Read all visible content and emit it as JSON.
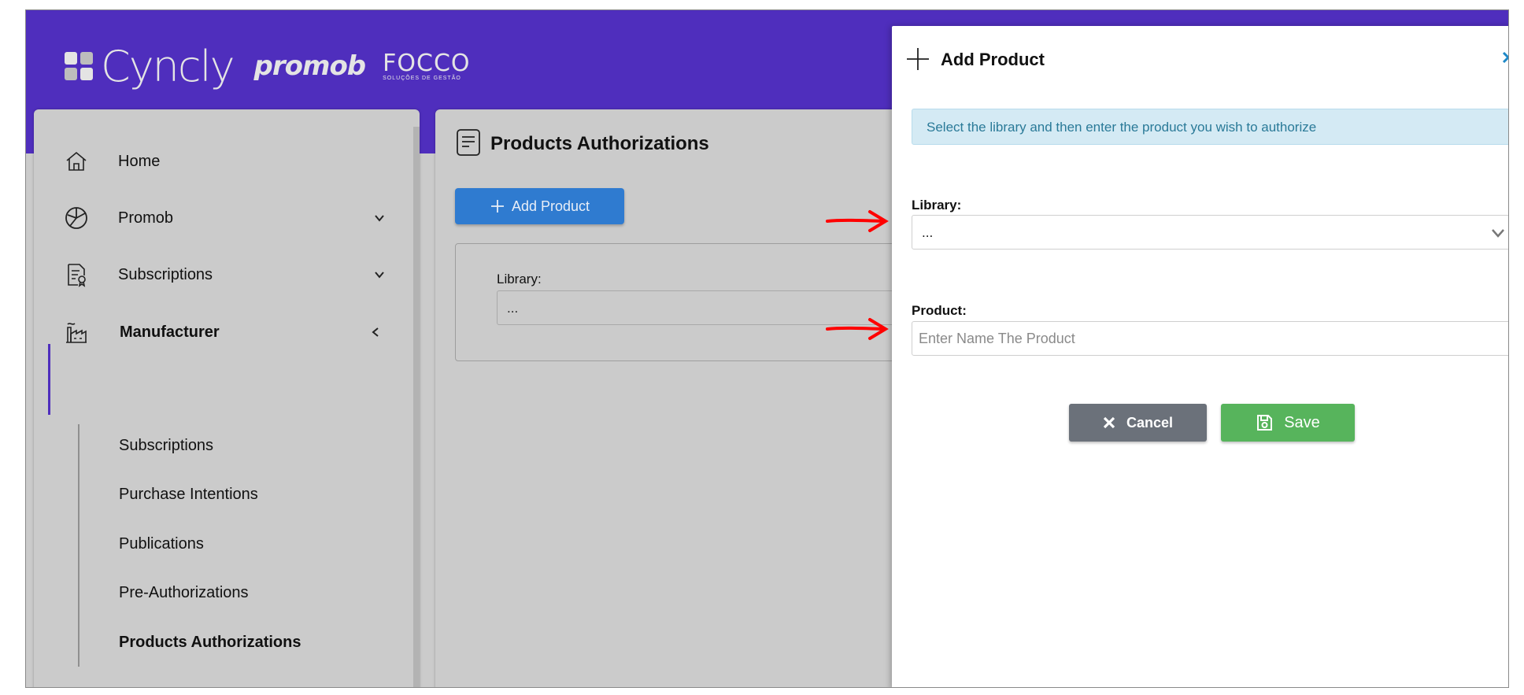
{
  "brand": {
    "name": "Cyncly",
    "partner1": "promob",
    "partner2": "FOCCO",
    "partner2_sub": "SOLUÇÕES DE GESTÃO"
  },
  "sidebar": {
    "items": [
      {
        "label": "Home",
        "icon": "home-icon"
      },
      {
        "label": "Promob",
        "icon": "promob-icon"
      },
      {
        "label": "Subscriptions",
        "icon": "subscriptions-icon"
      },
      {
        "label": "Manufacturer",
        "icon": "factory-icon"
      }
    ],
    "subitems": [
      {
        "label": "Subscriptions"
      },
      {
        "label": "Purchase Intentions"
      },
      {
        "label": "Publications"
      },
      {
        "label": "Pre-Authorizations"
      },
      {
        "label": "Products Authorizations"
      }
    ]
  },
  "main": {
    "title": "Products Authorizations",
    "add_button": "Add Product",
    "filter": {
      "library_label": "Library:",
      "library_value": "..."
    }
  },
  "modal": {
    "title": "Add Product",
    "info": "Select the library and then enter the product you wish to authorize",
    "library_label": "Library:",
    "library_value": "...",
    "product_label": "Product:",
    "product_placeholder": "Enter Name The Product",
    "product_value": "",
    "cancel_label": "Cancel",
    "save_label": "Save"
  },
  "colors": {
    "brand_purple": "#4f2ebd",
    "primary_blue": "#2f7bd0",
    "cancel_gray": "#6b717a",
    "save_green": "#57b45c",
    "info_bg": "#d4eaf4",
    "annotation_red": "#ff0000"
  }
}
